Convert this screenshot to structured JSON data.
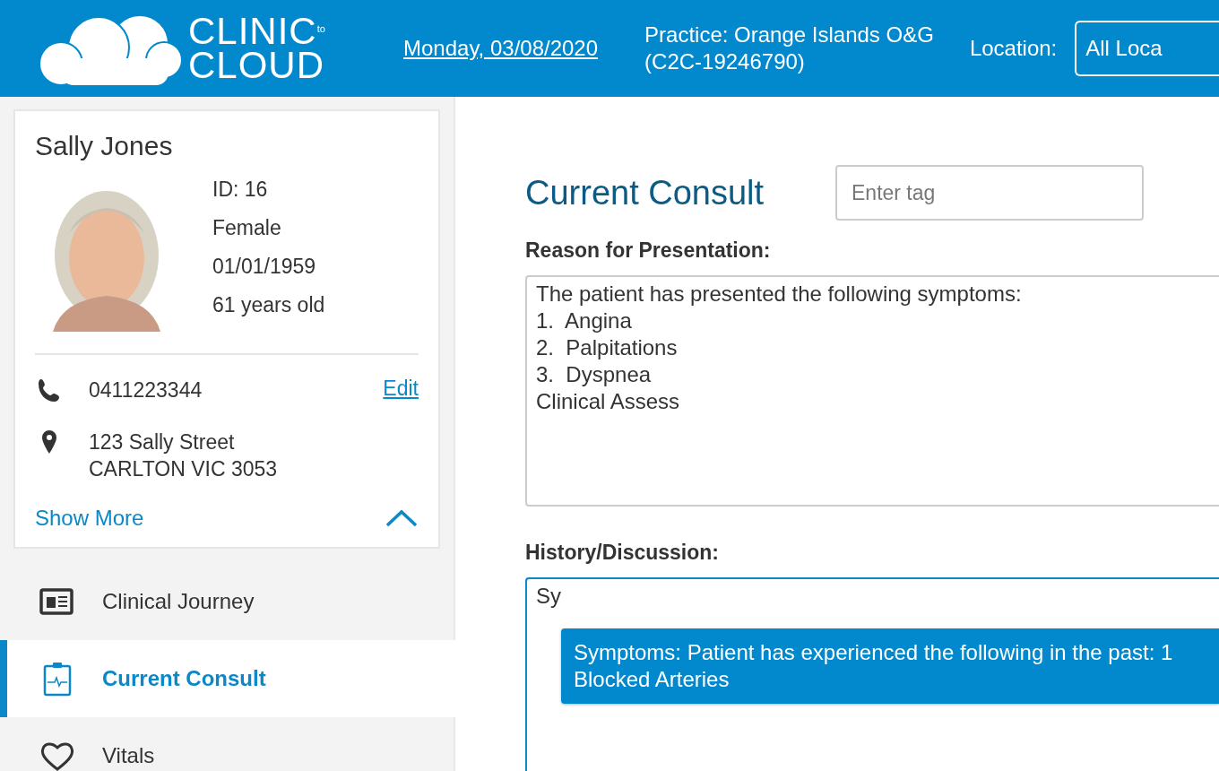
{
  "header": {
    "logo": {
      "line_1": "CLINIC",
      "small": "to",
      "line_2": "CLOUD"
    },
    "date": "Monday, 03/08/2020",
    "practice": [
      "Practice: Orange Islands O&G",
      "(C2C-19246790)"
    ],
    "location_label": "Location:",
    "location_value": "All Loca"
  },
  "patient": {
    "name": "Sally Jones",
    "photo": {
      "kind": "picture"
    },
    "details": [
      "ID: 16",
      "Female",
      "01/01/1959",
      "61 years old"
    ],
    "phone": "0411223344",
    "edit": "Edit",
    "address": [
      "123 Sally Street",
      "CARLTON VIC 3053"
    ],
    "show_more": "Show More",
    "expanded": true
  },
  "nav": [
    {
      "label": "Clinical Journey",
      "selected": false
    },
    {
      "label": "Current Consult",
      "selected": true
    },
    {
      "label": "Vitals",
      "selected": false
    }
  ],
  "consult": {
    "title": "Current Consult",
    "tag_field": {
      "placeholder": "Enter tag"
    },
    "reason_label": "Reason for Presentation:",
    "reason_value": "The patient has presented the following symptoms:\n1.  Angina\n2.  Palpitations\n3.  Dyspnea\nClinical Assess",
    "history_label": "History/Discussion:",
    "history_value": "Sy",
    "suggestion": [
      "Symptoms: Patient has experienced the following in the past: 1",
      "Blocked Arteries"
    ]
  }
}
